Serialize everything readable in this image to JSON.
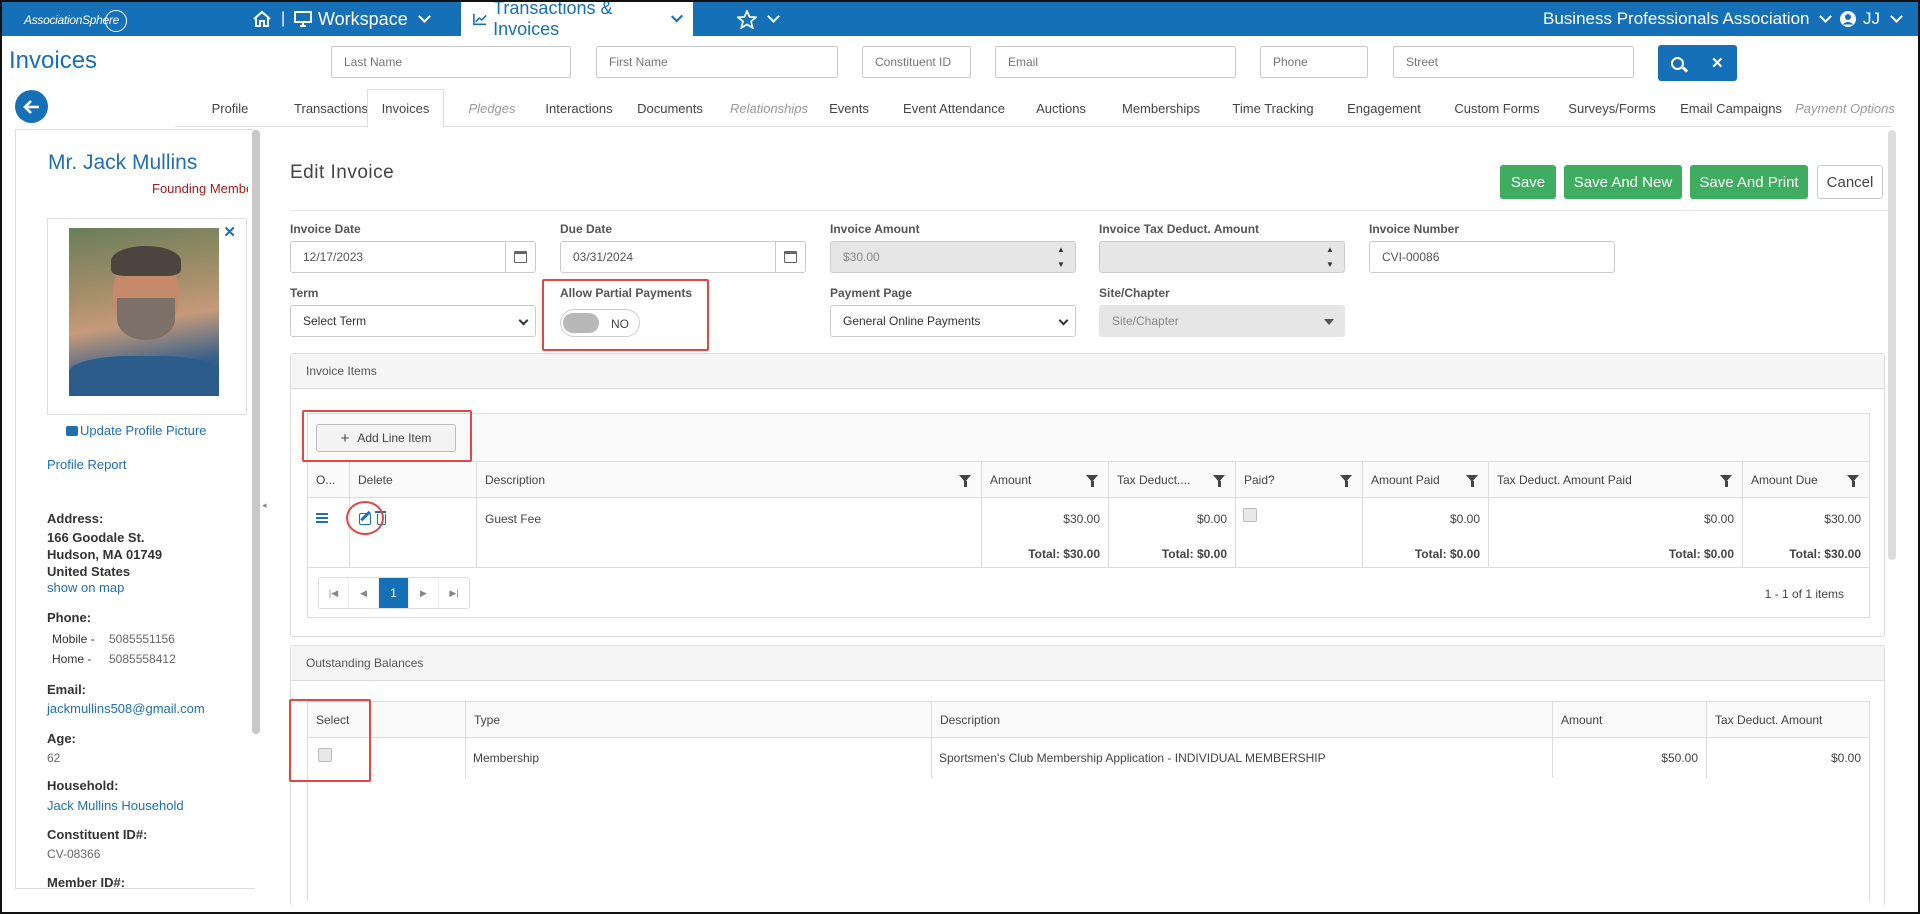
{
  "topnav": {
    "logo": "AssociationSphere",
    "workspace": "Workspace",
    "transactions": "Transactions & Invoices",
    "org": "Business Professionals Association",
    "user": "JJ",
    "sep": "|"
  },
  "page_title": "Invoices",
  "search": {
    "last_name": "Last Name",
    "first_name": "First Name",
    "constituent_id": "Constituent ID",
    "email": "Email",
    "phone": "Phone",
    "street": "Street",
    "clear": "✕"
  },
  "tabs": [
    "Profile",
    "Transactions",
    "Invoices",
    "Pledges",
    "Interactions",
    "Documents",
    "Relationships",
    "Events",
    "Event Attendance",
    "Auctions",
    "Memberships",
    "Time Tracking",
    "Engagement",
    "Custom Forms",
    "Surveys/Forms",
    "Email Campaigns",
    "Payment Options"
  ],
  "profile": {
    "name": "Mr. Jack Mullins",
    "role": "Founding Member",
    "update_picture": "Update Profile Picture",
    "profile_report": "Profile Report",
    "address_label": "Address:",
    "address_line1": "166 Goodale St.",
    "address_line2": "Hudson, MA 01749",
    "address_line3": "United States",
    "show_on_map": "show on map",
    "phone_label": "Phone:",
    "mobile_label": "Mobile -",
    "mobile": "5085551156",
    "home_label": "Home -",
    "home": "5085558412",
    "email_label": "Email:",
    "email": "jackmullins508@gmail.com",
    "age_label": "Age:",
    "age": "62",
    "household_label": "Household:",
    "household": "Jack Mullins Household",
    "constituent_label": "Constituent ID#:",
    "constituent_id": "CV-08366",
    "member_label": "Member ID#:"
  },
  "form": {
    "title": "Edit Invoice",
    "save": "Save",
    "save_new": "Save And New",
    "save_print": "Save And Print",
    "cancel": "Cancel",
    "invoice_date_label": "Invoice Date",
    "invoice_date": "12/17/2023",
    "due_date_label": "Due Date",
    "due_date": "03/31/2024",
    "amount_label": "Invoice Amount",
    "amount": "$30.00",
    "tax_label": "Invoice Tax Deduct. Amount",
    "tax": "",
    "number_label": "Invoice Number",
    "number": "CVI-00086",
    "term_label": "Term",
    "term": "Select Term",
    "partial_label": "Allow Partial Payments",
    "partial": "NO",
    "payment_page_label": "Payment Page",
    "payment_page": "General Online Payments",
    "site_label": "Site/Chapter",
    "site": "Site/Chapter"
  },
  "invoice_items": {
    "title": "Invoice Items",
    "add_label": "Add Line Item",
    "columns": [
      "O...",
      "Delete",
      "Description",
      "Amount",
      "Tax Deduct....",
      "Paid?",
      "Amount Paid",
      "Tax Deduct. Amount Paid",
      "Amount Due"
    ],
    "row": {
      "description": "Guest Fee",
      "amount": "$30.00",
      "tax": "$0.00",
      "amount_paid": "$0.00",
      "tax_paid": "$0.00",
      "amount_due": "$30.00"
    },
    "totals": {
      "amount": "Total: $30.00",
      "tax": "Total: $0.00",
      "amount_paid": "Total: $0.00",
      "tax_paid": "Total: $0.00",
      "amount_due": "Total: $30.00"
    },
    "page": "1",
    "pager_info": "1 - 1 of 1 items",
    "nav_first": "|◀",
    "nav_prev": "◀",
    "nav_next": "▶",
    "nav_last": "▶|"
  },
  "balances": {
    "title": "Outstanding Balances",
    "columns": [
      "Select",
      "Type",
      "Description",
      "Amount",
      "Tax Deduct. Amount"
    ],
    "row": {
      "type": "Membership",
      "description": "Sportsmen's Club Membership Application - INDIVIDUAL MEMBERSHIP",
      "amount": "$50.00",
      "tax": "$0.00"
    }
  }
}
